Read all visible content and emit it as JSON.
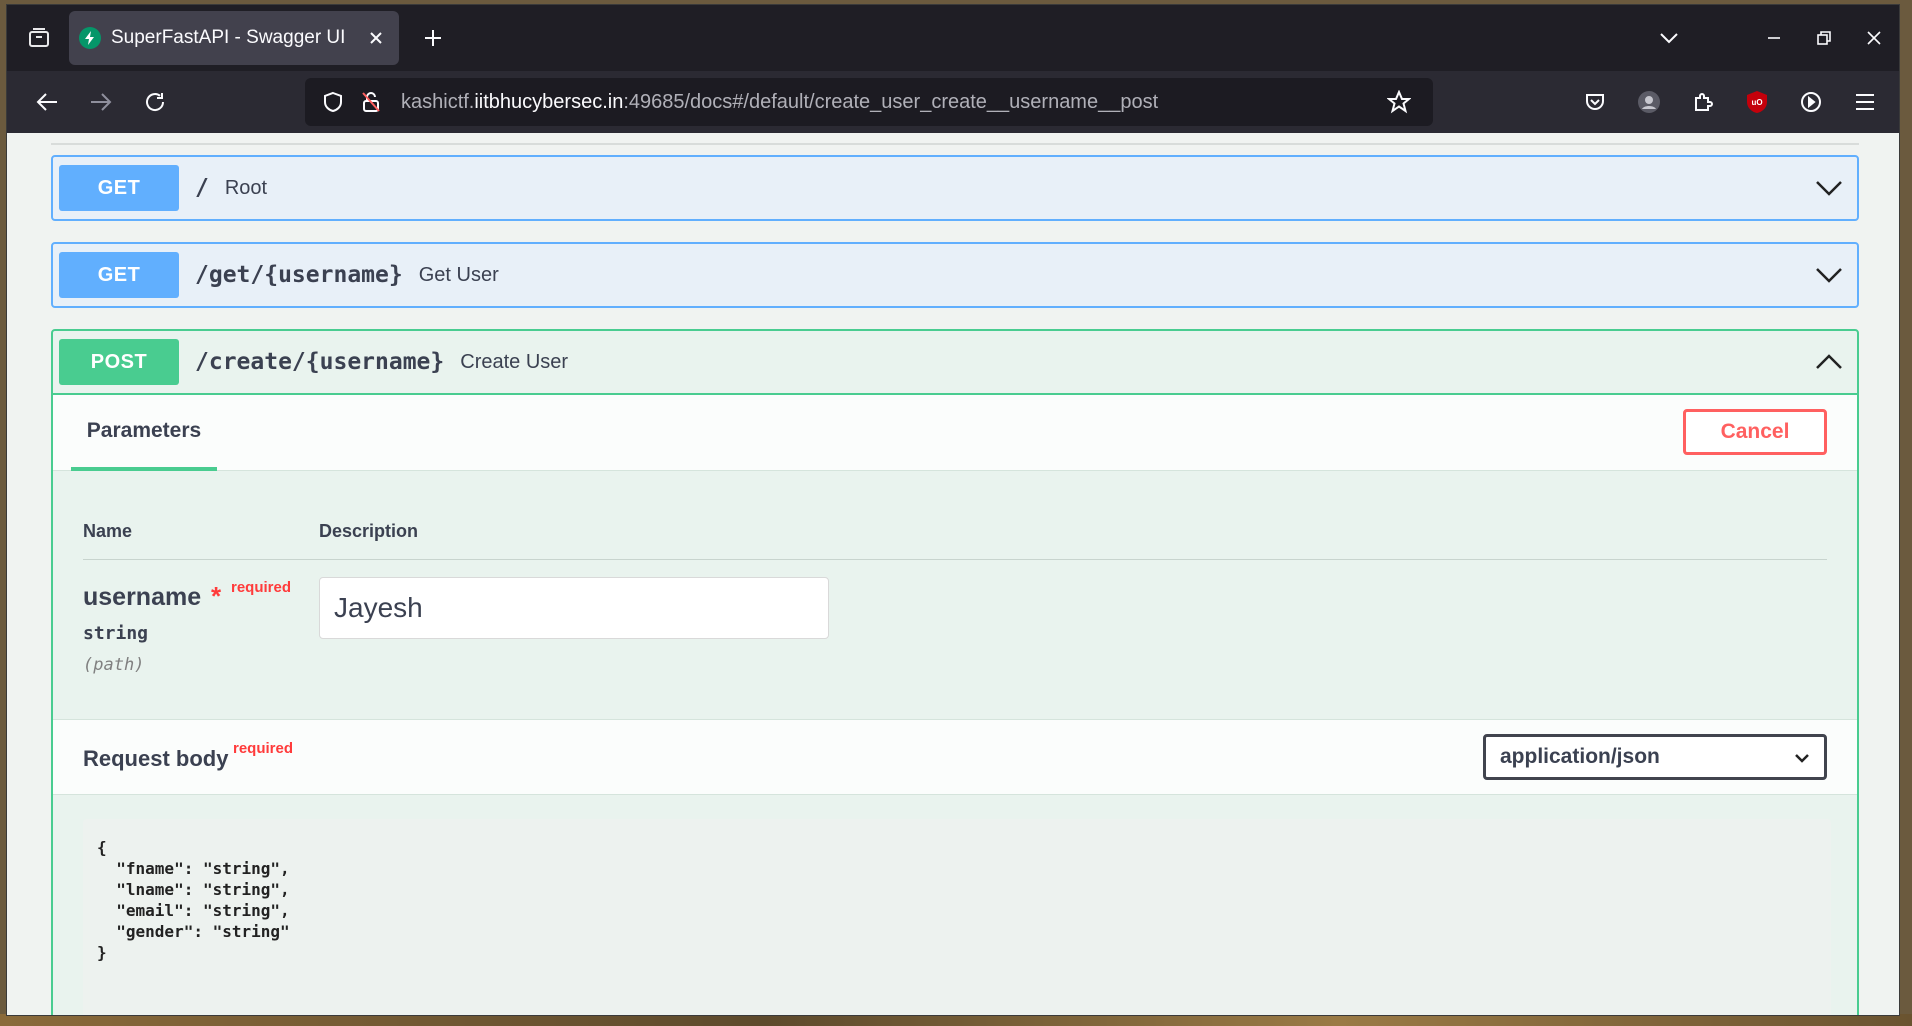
{
  "browser": {
    "tab_title": "SuperFastAPI - Swagger UI",
    "url": {
      "prefix": "kashictf.",
      "domain": "iitbhucybersec.in",
      "rest": ":49685/docs#/default/create_user_create__username__post"
    }
  },
  "operations": [
    {
      "method": "GET",
      "path": "/",
      "summary": "Root"
    },
    {
      "method": "GET",
      "path": "/get/{username}",
      "summary": "Get User"
    },
    {
      "method": "POST",
      "path": "/create/{username}",
      "summary": "Create User"
    }
  ],
  "expanded": {
    "tab_label": "Parameters",
    "cancel_label": "Cancel",
    "table_headers": {
      "name": "Name",
      "description": "Description"
    },
    "param": {
      "name": "username",
      "star": "*",
      "required": "required",
      "type": "string",
      "in": "(path)",
      "value": "Jayesh"
    },
    "request_body": {
      "title": "Request body",
      "required": "required",
      "content_type": "application/json",
      "lines": [
        "{",
        "  \"fname\": \"string\",",
        "  \"lname\": \"string\",",
        "  \"email\": \"string\",",
        "  \"gender\": \"string\"",
        "}"
      ]
    }
  },
  "colors": {
    "get": "#61affe",
    "post": "#49cc90",
    "cancel": "#ff6060",
    "required": "#ff3b3b"
  }
}
